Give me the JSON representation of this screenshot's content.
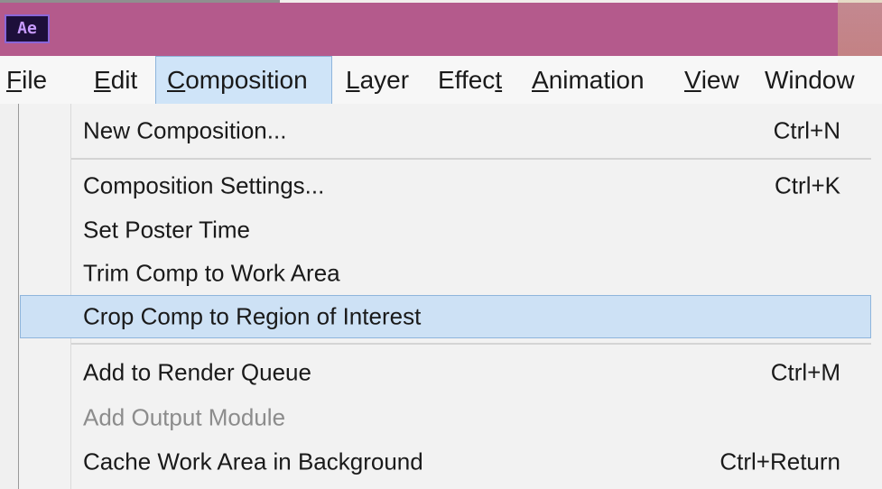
{
  "app": {
    "icon_text": "Ae",
    "title_color": "#b45a8c",
    "icon_name": "after-effects-app-icon"
  },
  "menubar": {
    "items": [
      {
        "key": "F",
        "rest": "ile",
        "pre": ""
      },
      {
        "key": "E",
        "rest": "dit",
        "pre": ""
      },
      {
        "key": "C",
        "rest": "omposition",
        "pre": ""
      },
      {
        "key": "L",
        "rest": "ayer",
        "pre": ""
      },
      {
        "key": "t",
        "rest": "",
        "pre": "Effec"
      },
      {
        "key": "A",
        "rest": "nimation",
        "pre": ""
      },
      {
        "key": "V",
        "rest": "iew",
        "pre": ""
      },
      {
        "key": "",
        "rest": "Window",
        "pre": ""
      }
    ],
    "active_item": "Composition"
  },
  "menu": {
    "items": [
      {
        "label": "New Composition...",
        "shortcut": "Ctrl+N"
      },
      {
        "label": "Composition Settings...",
        "shortcut": "Ctrl+K"
      },
      {
        "label": "Set Poster Time",
        "shortcut": ""
      },
      {
        "label": "Trim Comp to Work Area",
        "shortcut": ""
      },
      {
        "label": "Crop Comp to Region of Interest",
        "shortcut": ""
      },
      {
        "label": "Add to Render Queue",
        "shortcut": "Ctrl+M"
      },
      {
        "label": "Add Output Module",
        "shortcut": ""
      },
      {
        "label": "Cache Work Area in Background",
        "shortcut": "Ctrl+Return"
      }
    ],
    "highlighted_item": "Crop Comp to Region of Interest",
    "disabled_items": [
      "Add Output Module"
    ],
    "highlight_color": "#cde1f5"
  }
}
